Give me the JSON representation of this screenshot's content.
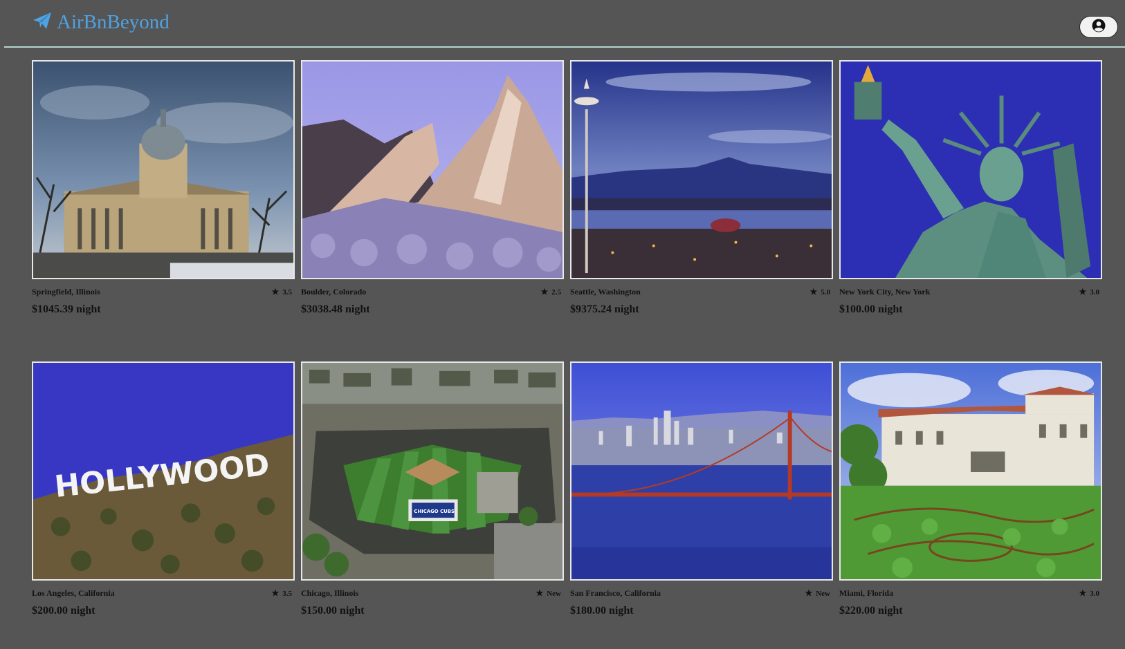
{
  "app": {
    "title": "AirBnBeyond"
  },
  "header": {
    "logo_icon": "paper-plane-icon",
    "profile_icon": "user-circle-icon"
  },
  "listings": [
    {
      "location": "Springfield, Illinois",
      "rating": "3.5",
      "price": "$1045.39 night",
      "scene": "capitol"
    },
    {
      "location": "Boulder, Colorado",
      "rating": "2.5",
      "price": "$3038.48 night",
      "scene": "mountain"
    },
    {
      "location": "Seattle, Washington",
      "rating": "5.0",
      "price": "$9375.24 night",
      "scene": "seattle"
    },
    {
      "location": "New York City, New York",
      "rating": "3.0",
      "price": "$100.00 night",
      "scene": "liberty"
    },
    {
      "location": "Los Angeles, California",
      "rating": "3.5",
      "price": "$200.00 night",
      "scene": "hollywood"
    },
    {
      "location": "Chicago, Illinois",
      "rating": "New",
      "price": "$150.00 night",
      "scene": "stadium"
    },
    {
      "location": "San Francisco, California",
      "rating": "New",
      "price": "$180.00 night",
      "scene": "bridge"
    },
    {
      "location": "Miami, Florida",
      "rating": "3.0",
      "price": "$220.00 night",
      "scene": "villa"
    }
  ],
  "photo_text": {
    "hollywood": "HOLLYWOOD",
    "stadium": "CHICAGO CUBS"
  },
  "colors": {
    "background": "#555555",
    "accent": "#4fa3e3",
    "header_rule": "#b7d3d0"
  }
}
